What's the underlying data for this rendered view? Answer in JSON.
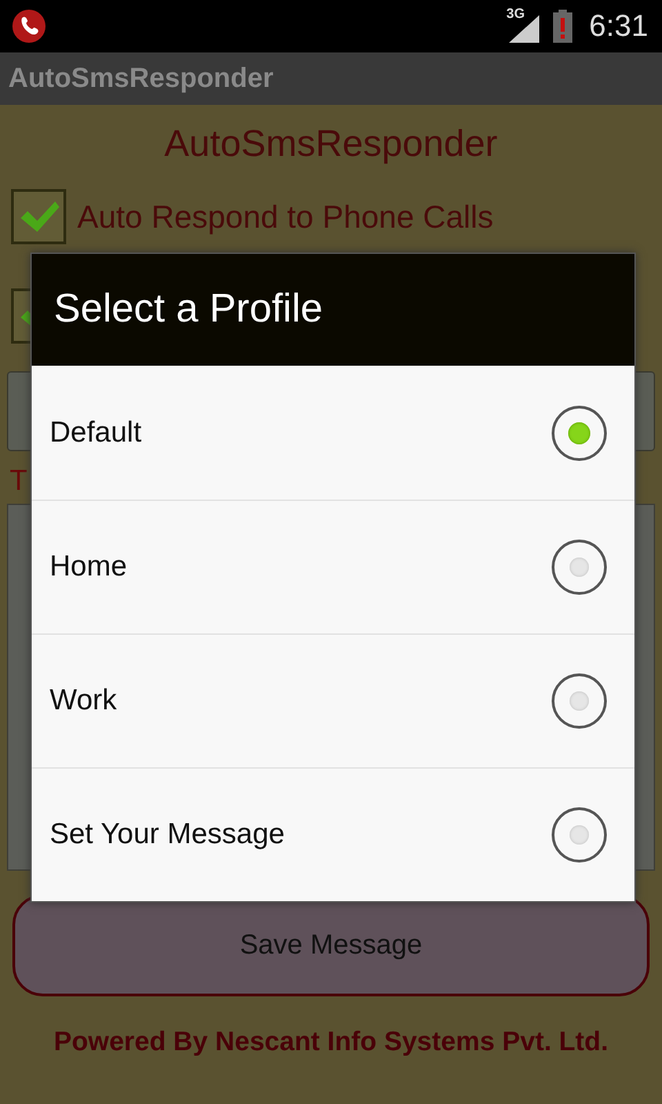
{
  "status_bar": {
    "time": "6:31",
    "network": "3G"
  },
  "action_bar": {
    "title": "AutoSmsResponder"
  },
  "heading": "AutoSmsResponder",
  "checkboxes": [
    {
      "label": "Auto Respond to Phone Calls",
      "checked": true
    },
    {
      "checked": true
    }
  ],
  "message_label": "T",
  "save_button": "Save Message",
  "footer": "Powered By Nescant Info Systems Pvt. Ltd.",
  "dialog": {
    "title": "Select a Profile",
    "options": [
      {
        "label": "Default",
        "selected": true
      },
      {
        "label": "Home",
        "selected": false
      },
      {
        "label": "Work",
        "selected": false
      },
      {
        "label": "Set Your Message",
        "selected": false
      }
    ]
  }
}
